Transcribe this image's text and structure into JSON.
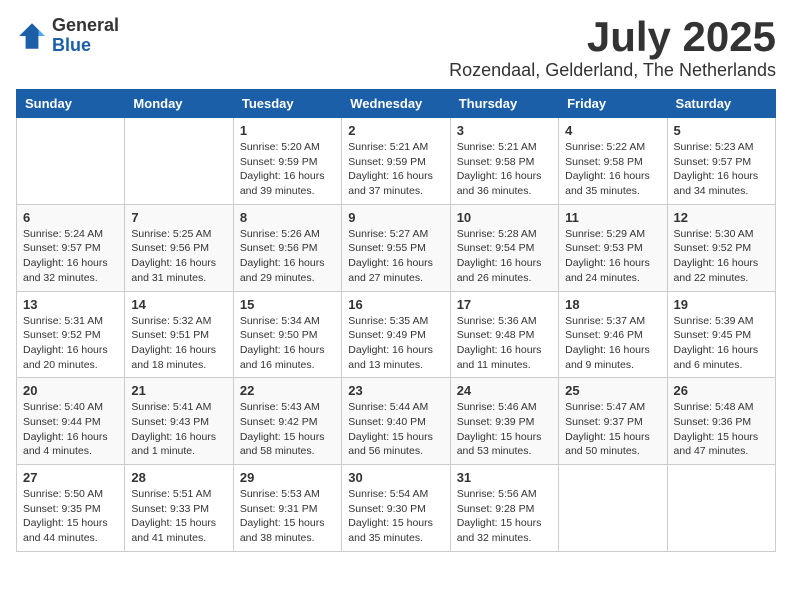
{
  "logo": {
    "general": "General",
    "blue": "Blue"
  },
  "title": "July 2025",
  "location": "Rozendaal, Gelderland, The Netherlands",
  "days_of_week": [
    "Sunday",
    "Monday",
    "Tuesday",
    "Wednesday",
    "Thursday",
    "Friday",
    "Saturday"
  ],
  "weeks": [
    [
      {
        "day": "",
        "info": ""
      },
      {
        "day": "",
        "info": ""
      },
      {
        "day": "1",
        "info": "Sunrise: 5:20 AM\nSunset: 9:59 PM\nDaylight: 16 hours and 39 minutes."
      },
      {
        "day": "2",
        "info": "Sunrise: 5:21 AM\nSunset: 9:59 PM\nDaylight: 16 hours and 37 minutes."
      },
      {
        "day": "3",
        "info": "Sunrise: 5:21 AM\nSunset: 9:58 PM\nDaylight: 16 hours and 36 minutes."
      },
      {
        "day": "4",
        "info": "Sunrise: 5:22 AM\nSunset: 9:58 PM\nDaylight: 16 hours and 35 minutes."
      },
      {
        "day": "5",
        "info": "Sunrise: 5:23 AM\nSunset: 9:57 PM\nDaylight: 16 hours and 34 minutes."
      }
    ],
    [
      {
        "day": "6",
        "info": "Sunrise: 5:24 AM\nSunset: 9:57 PM\nDaylight: 16 hours and 32 minutes."
      },
      {
        "day": "7",
        "info": "Sunrise: 5:25 AM\nSunset: 9:56 PM\nDaylight: 16 hours and 31 minutes."
      },
      {
        "day": "8",
        "info": "Sunrise: 5:26 AM\nSunset: 9:56 PM\nDaylight: 16 hours and 29 minutes."
      },
      {
        "day": "9",
        "info": "Sunrise: 5:27 AM\nSunset: 9:55 PM\nDaylight: 16 hours and 27 minutes."
      },
      {
        "day": "10",
        "info": "Sunrise: 5:28 AM\nSunset: 9:54 PM\nDaylight: 16 hours and 26 minutes."
      },
      {
        "day": "11",
        "info": "Sunrise: 5:29 AM\nSunset: 9:53 PM\nDaylight: 16 hours and 24 minutes."
      },
      {
        "day": "12",
        "info": "Sunrise: 5:30 AM\nSunset: 9:52 PM\nDaylight: 16 hours and 22 minutes."
      }
    ],
    [
      {
        "day": "13",
        "info": "Sunrise: 5:31 AM\nSunset: 9:52 PM\nDaylight: 16 hours and 20 minutes."
      },
      {
        "day": "14",
        "info": "Sunrise: 5:32 AM\nSunset: 9:51 PM\nDaylight: 16 hours and 18 minutes."
      },
      {
        "day": "15",
        "info": "Sunrise: 5:34 AM\nSunset: 9:50 PM\nDaylight: 16 hours and 16 minutes."
      },
      {
        "day": "16",
        "info": "Sunrise: 5:35 AM\nSunset: 9:49 PM\nDaylight: 16 hours and 13 minutes."
      },
      {
        "day": "17",
        "info": "Sunrise: 5:36 AM\nSunset: 9:48 PM\nDaylight: 16 hours and 11 minutes."
      },
      {
        "day": "18",
        "info": "Sunrise: 5:37 AM\nSunset: 9:46 PM\nDaylight: 16 hours and 9 minutes."
      },
      {
        "day": "19",
        "info": "Sunrise: 5:39 AM\nSunset: 9:45 PM\nDaylight: 16 hours and 6 minutes."
      }
    ],
    [
      {
        "day": "20",
        "info": "Sunrise: 5:40 AM\nSunset: 9:44 PM\nDaylight: 16 hours and 4 minutes."
      },
      {
        "day": "21",
        "info": "Sunrise: 5:41 AM\nSunset: 9:43 PM\nDaylight: 16 hours and 1 minute."
      },
      {
        "day": "22",
        "info": "Sunrise: 5:43 AM\nSunset: 9:42 PM\nDaylight: 15 hours and 58 minutes."
      },
      {
        "day": "23",
        "info": "Sunrise: 5:44 AM\nSunset: 9:40 PM\nDaylight: 15 hours and 56 minutes."
      },
      {
        "day": "24",
        "info": "Sunrise: 5:46 AM\nSunset: 9:39 PM\nDaylight: 15 hours and 53 minutes."
      },
      {
        "day": "25",
        "info": "Sunrise: 5:47 AM\nSunset: 9:37 PM\nDaylight: 15 hours and 50 minutes."
      },
      {
        "day": "26",
        "info": "Sunrise: 5:48 AM\nSunset: 9:36 PM\nDaylight: 15 hours and 47 minutes."
      }
    ],
    [
      {
        "day": "27",
        "info": "Sunrise: 5:50 AM\nSunset: 9:35 PM\nDaylight: 15 hours and 44 minutes."
      },
      {
        "day": "28",
        "info": "Sunrise: 5:51 AM\nSunset: 9:33 PM\nDaylight: 15 hours and 41 minutes."
      },
      {
        "day": "29",
        "info": "Sunrise: 5:53 AM\nSunset: 9:31 PM\nDaylight: 15 hours and 38 minutes."
      },
      {
        "day": "30",
        "info": "Sunrise: 5:54 AM\nSunset: 9:30 PM\nDaylight: 15 hours and 35 minutes."
      },
      {
        "day": "31",
        "info": "Sunrise: 5:56 AM\nSunset: 9:28 PM\nDaylight: 15 hours and 32 minutes."
      },
      {
        "day": "",
        "info": ""
      },
      {
        "day": "",
        "info": ""
      }
    ]
  ]
}
